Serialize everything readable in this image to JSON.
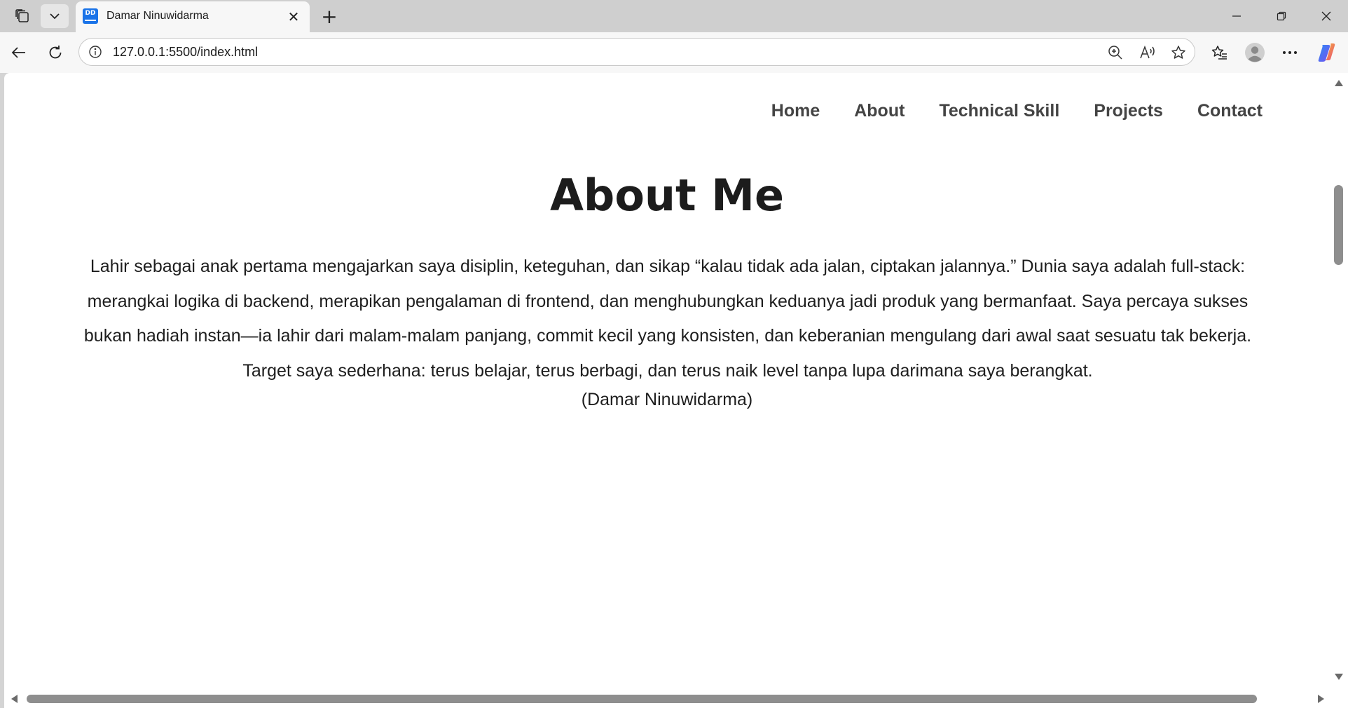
{
  "browser": {
    "tab": {
      "favicon_text": "DD",
      "title": "Damar Ninuwidarma",
      "close_glyph": "✕"
    },
    "new_tab_glyph": "+",
    "address": {
      "url": "127.0.0.1:5500/index.html"
    },
    "icons": {
      "workspaces": "workspaces-icon",
      "tab_list": "chevron-down-icon",
      "back": "back-arrow-icon",
      "reload": "reload-icon",
      "site_info": "info-icon",
      "zoom": "zoom-in-icon",
      "read_aloud": "read-aloud-icon",
      "favorite": "star-icon",
      "favorites": "favorites-icon",
      "profile": "profile-avatar-icon",
      "more": "more-options-icon",
      "copilot": "copilot-icon"
    }
  },
  "page": {
    "nav": [
      {
        "label": "Home"
      },
      {
        "label": "About"
      },
      {
        "label": "Technical Skill"
      },
      {
        "label": "Projects"
      },
      {
        "label": "Contact"
      }
    ],
    "about": {
      "heading": "About Me",
      "text": "Lahir sebagai anak pertama mengajarkan saya disiplin, keteguhan, dan sikap “kalau tidak ada jalan, ciptakan jalannya.” Dunia saya adalah full-stack: merangkai logika di backend, merapikan pengalaman di frontend, dan menghubungkan keduanya jadi produk yang bermanfaat. Saya percaya sukses bukan hadiah instan—ia lahir dari malam-malam panjang, commit kecil yang konsisten, dan keberanian mengulang dari awal saat sesuatu tak bekerja. Target saya sederhana: terus belajar, terus berbagi, dan terus naik level tanpa lupa darimana saya berangkat.",
      "signature": "(Damar Ninuwidarma)"
    }
  },
  "colors": {
    "nav_text": "#444444",
    "body_text": "#1e1e1e",
    "favicon_bg": "#1a73e8",
    "scroll_thumb": "#8e8e8e"
  }
}
